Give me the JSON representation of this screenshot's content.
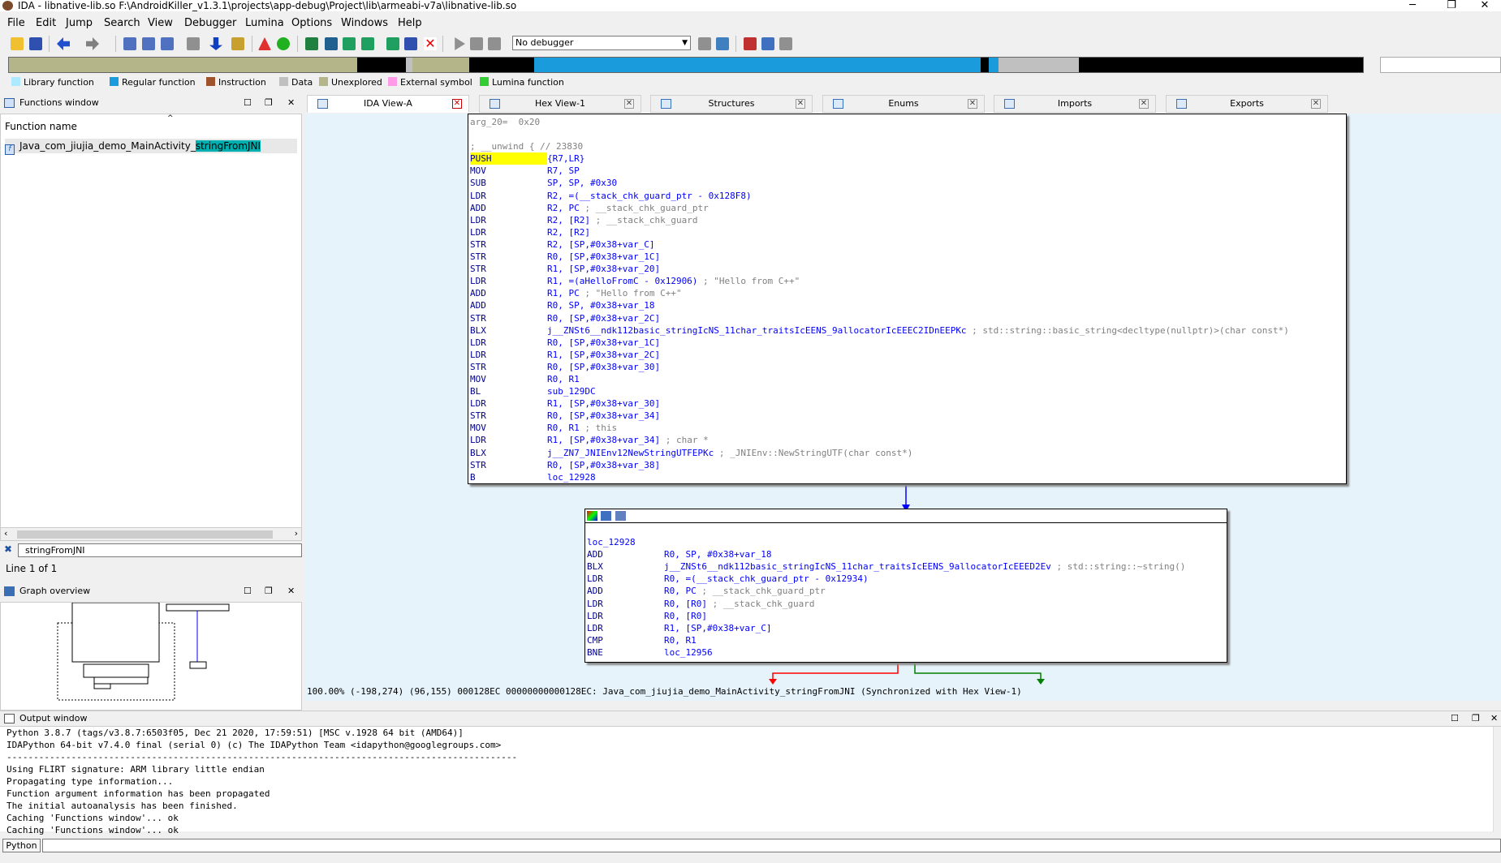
{
  "window": {
    "title": "IDA - libnative-lib.so F:\\AndroidKiller_v1.3.1\\projects\\app-debug\\Project\\lib\\armeabi-v7a\\libnative-lib.so",
    "minimize": "─",
    "restore": "❐",
    "close": "✕"
  },
  "menu": [
    "File",
    "Edit",
    "Jump",
    "Search",
    "View",
    "Debugger",
    "Lumina",
    "Options",
    "Windows",
    "Help"
  ],
  "toolbar": {
    "debugger_select": "No debugger"
  },
  "navband_colors": {
    "library": "#aeeaff",
    "regular": "#1a9bdb",
    "instruction": "#a0522d",
    "data": "#c0c0c0",
    "unexplored": "#b5b58a",
    "external": "#ff9be6",
    "lumina": "#33cc33"
  },
  "legend": [
    {
      "label": "Library function",
      "color": "#aeeaff"
    },
    {
      "label": "Regular function",
      "color": "#1a9bdb"
    },
    {
      "label": "Instruction",
      "color": "#a0522d"
    },
    {
      "label": "Data",
      "color": "#c0c0c0"
    },
    {
      "label": "Unexplored",
      "color": "#b5b58a"
    },
    {
      "label": "External symbol",
      "color": "#ff9be6"
    },
    {
      "label": "Lumina function",
      "color": "#33cc33"
    }
  ],
  "functions_window": {
    "title": "Functions window",
    "column": "Function name",
    "row_prefix": "Java_com_jiujia_demo_MainActivity_",
    "row_match": "stringFromJNI",
    "search_text": "stringFromJNI",
    "line_info": "Line 1 of 1"
  },
  "graph_overview": {
    "title": "Graph overview"
  },
  "tabs": [
    {
      "label": "IDA View-A"
    },
    {
      "label": "Hex View-1"
    },
    {
      "label": "Structures"
    },
    {
      "label": "Enums"
    },
    {
      "label": "Imports"
    },
    {
      "label": "Exports"
    }
  ],
  "block1": [
    {
      "c": "cm",
      "t": "arg_20=  0x20"
    },
    {
      "c": "",
      "t": ""
    },
    {
      "c": "cm",
      "t": "; __unwind { // 23830"
    },
    {
      "m": "PUSH",
      "a": "{R7,LR}",
      "push": true
    },
    {
      "m": "MOV",
      "a": "R7, SP"
    },
    {
      "m": "SUB",
      "a": "SP, SP, #0x30"
    },
    {
      "m": "LDR",
      "a": "R2, =(__stack_chk_guard_ptr - 0x128F8)"
    },
    {
      "m": "ADD",
      "a": "R2, PC",
      "cmt": "; __stack_chk_guard_ptr"
    },
    {
      "m": "LDR",
      "a": "R2, [R2]",
      "cmt": "; __stack_chk_guard"
    },
    {
      "m": "LDR",
      "a": "R2, [R2]"
    },
    {
      "m": "STR",
      "a": "R2, [SP,#0x38+var_C]"
    },
    {
      "m": "STR",
      "a": "R0, [SP,#0x38+var_1C]"
    },
    {
      "m": "STR",
      "a": "R1, [SP,#0x38+var_20]"
    },
    {
      "m": "LDR",
      "a": "R1, =(aHelloFromC - 0x12906)",
      "cmt": "; \"Hello from C++\""
    },
    {
      "m": "ADD",
      "a": "R1, PC",
      "cmt": "; \"Hello from C++\""
    },
    {
      "m": "ADD",
      "a": "R0, SP, #0x38+var_18"
    },
    {
      "m": "STR",
      "a": "R0, [SP,#0x38+var_2C]"
    },
    {
      "m": "BLX",
      "a": "j__ZNSt6__ndk112basic_stringIcNS_11char_traitsIcEENS_9allocatorIcEEEC2IDnEEPKc",
      "cmt": "; std::string::basic_string<decltype(nullptr)>(char const*)"
    },
    {
      "m": "LDR",
      "a": "R0, [SP,#0x38+var_1C]"
    },
    {
      "m": "LDR",
      "a": "R1, [SP,#0x38+var_2C]"
    },
    {
      "m": "STR",
      "a": "R0, [SP,#0x38+var_30]"
    },
    {
      "m": "MOV",
      "a": "R0, R1"
    },
    {
      "m": "BL",
      "a": "sub_129DC"
    },
    {
      "m": "LDR",
      "a": "R1, [SP,#0x38+var_30]"
    },
    {
      "m": "STR",
      "a": "R0, [SP,#0x38+var_34]"
    },
    {
      "m": "MOV",
      "a": "R0, R1",
      "cmt": "; this"
    },
    {
      "m": "LDR",
      "a": "R1, [SP,#0x38+var_34]",
      "cmt": "; char *"
    },
    {
      "m": "BLX",
      "a": "j__ZN7_JNIEnv12NewStringUTFEPKc",
      "cmt": "; _JNIEnv::NewStringUTF(char const*)"
    },
    {
      "m": "STR",
      "a": "R0, [SP,#0x38+var_38]"
    },
    {
      "m": "B",
      "a": "loc_12928"
    }
  ],
  "block2": [
    {
      "c": "",
      "t": ""
    },
    {
      "c": "nm",
      "t": "loc_12928"
    },
    {
      "m": "ADD",
      "a": "R0, SP, #0x38+var_18"
    },
    {
      "m": "BLX",
      "a": "j__ZNSt6__ndk112basic_stringIcNS_11char_traitsIcEENS_9allocatorIcEEED2Ev",
      "cmt": "; std::string::~string()"
    },
    {
      "m": "LDR",
      "a": "R0, =(__stack_chk_guard_ptr - 0x12934)"
    },
    {
      "m": "ADD",
      "a": "R0, PC",
      "cmt": "; __stack_chk_guard_ptr"
    },
    {
      "m": "LDR",
      "a": "R0, [R0]",
      "cmt": "; __stack_chk_guard"
    },
    {
      "m": "LDR",
      "a": "R0, [R0]"
    },
    {
      "m": "LDR",
      "a": "R1, [SP,#0x38+var_C]"
    },
    {
      "m": "CMP",
      "a": "R0, R1"
    },
    {
      "m": "BNE",
      "a": "loc_12956"
    }
  ],
  "status_line": "100.00% (-198,274) (96,155) 000128EC 00000000000128EC: Java_com_jiujia_demo_MainActivity_stringFromJNI (Synchronized with Hex View-1)",
  "output_window": {
    "title": "Output window",
    "lines": [
      "Python 3.8.7 (tags/v3.8.7:6503f05, Dec 21 2020, 17:59:51) [MSC v.1928 64 bit (AMD64)]",
      "IDAPython 64-bit v7.4.0 final (serial 0) (c) The IDAPython Team <idapython@googlegroups.com>",
      "-----------------------------------------------------------------------------------------------",
      "Using FLIRT signature: ARM library little endian",
      "Propagating type information...",
      "Function argument information has been propagated",
      "The initial autoanalysis has been finished.",
      "Caching 'Functions window'... ok",
      "Caching 'Functions window'... ok"
    ]
  },
  "python_button": "Python"
}
